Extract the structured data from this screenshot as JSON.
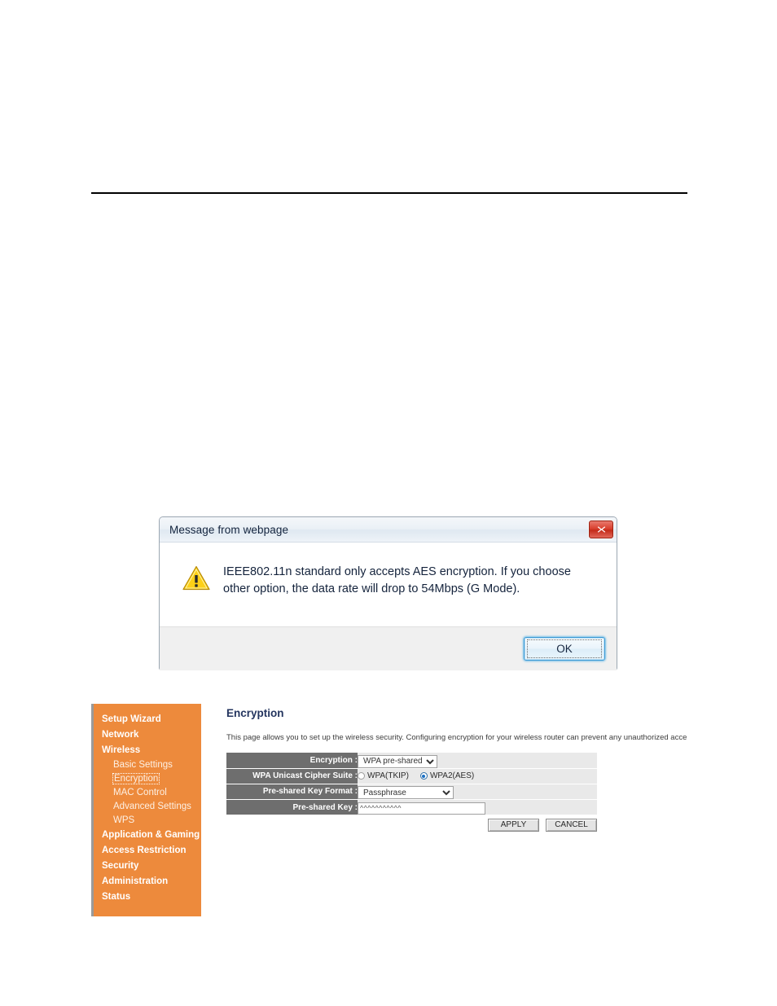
{
  "dialog": {
    "title": "Message from webpage",
    "message": "IEEE802.11n standard only accepts AES encryption. If you choose other option, the data rate will drop to 54Mbps (G Mode).",
    "ok_label": "OK",
    "close_icon": "close-icon",
    "warning_icon": "warning-triangle-icon"
  },
  "sidebar": {
    "accent_color": "#ED8A3C",
    "items": [
      {
        "label": "Setup Wizard",
        "type": "top"
      },
      {
        "label": "Network",
        "type": "top"
      },
      {
        "label": "Wireless",
        "type": "top"
      },
      {
        "label": "Basic Settings",
        "type": "sub"
      },
      {
        "label": "Encryption",
        "type": "sub",
        "focused": true
      },
      {
        "label": "MAC Control",
        "type": "sub"
      },
      {
        "label": "Advanced Settings",
        "type": "sub"
      },
      {
        "label": "WPS",
        "type": "sub"
      },
      {
        "label": "Application & Gaming",
        "type": "top"
      },
      {
        "label": "Access Restriction",
        "type": "top"
      },
      {
        "label": "Security",
        "type": "top"
      },
      {
        "label": "Administration",
        "type": "top"
      },
      {
        "label": "Status",
        "type": "top"
      }
    ]
  },
  "content": {
    "title": "Encryption",
    "title_color": "#24355F",
    "description": "This page allows you to set up the wireless security. Configuring encryption for your wireless router can prevent any unauthorized access to",
    "rows": {
      "encryption": {
        "label": "Encryption :",
        "value": "WPA pre-shared key",
        "options": [
          "WPA pre-shared key"
        ]
      },
      "cipher_suite": {
        "label": "WPA Unicast Cipher Suite :",
        "options": [
          {
            "label": "WPA(TKIP)",
            "selected": false
          },
          {
            "label": "WPA2(AES)",
            "selected": true
          }
        ]
      },
      "key_format": {
        "label": "Pre-shared Key Format :",
        "value": "Passphrase",
        "options": [
          "Passphrase"
        ]
      },
      "pre_shared_key": {
        "label": "Pre-shared Key :",
        "value": "^^^^^^^^^^^",
        "placeholder": ""
      }
    },
    "buttons": {
      "apply_label": "APPLY",
      "cancel_label": "CANCEL"
    }
  }
}
